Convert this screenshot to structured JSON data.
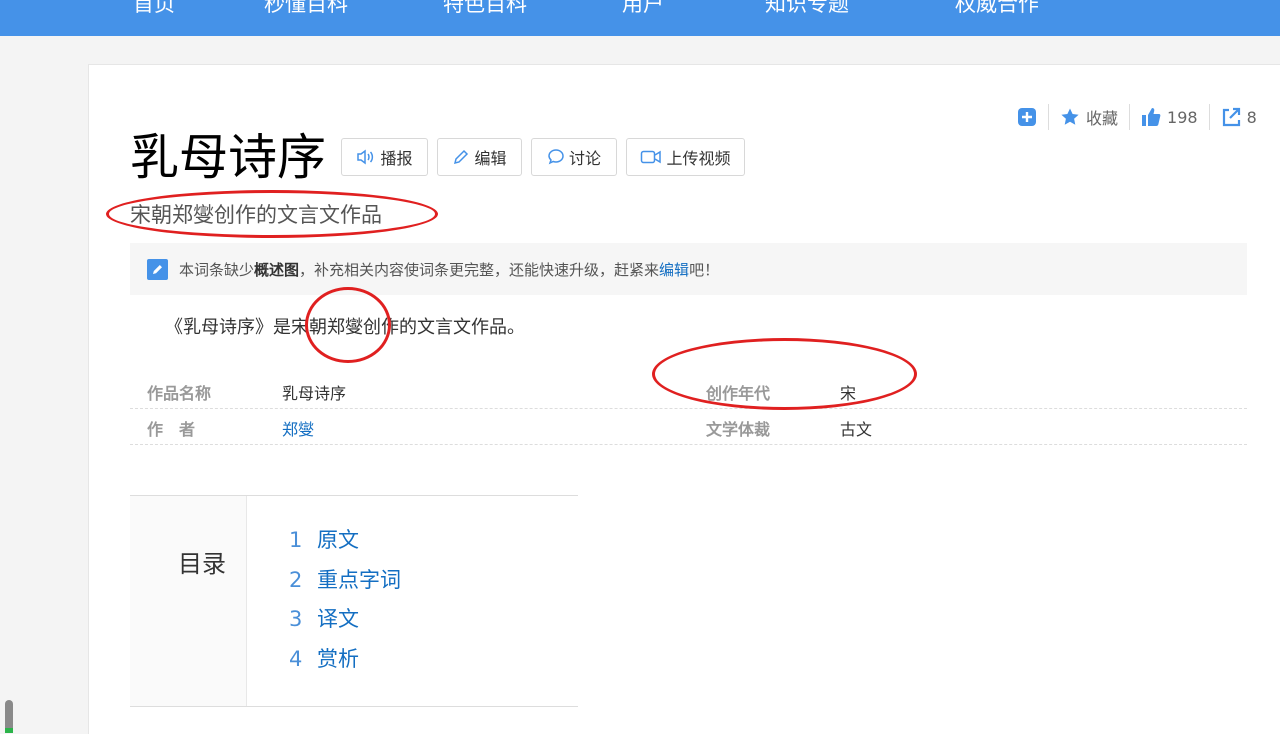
{
  "nav": {
    "items": [
      "首页",
      "秒懂百科",
      "特色百科",
      "用户",
      "知识专题",
      "权威合作"
    ]
  },
  "actions": {
    "collect_label": "收藏",
    "like_count": "198",
    "share_count": "8"
  },
  "entry": {
    "title": "乳母诗序",
    "buttons": {
      "broadcast": "播报",
      "edit": "编辑",
      "discuss": "讨论",
      "upload_video": "上传视频"
    },
    "subtitle": "宋朝郑燮创作的文言文作品",
    "notice": {
      "prefix": "本词条缺少",
      "bold": "概述图",
      "middle": "，补充相关内容使词条更完整，还能快速升级，赶紧来",
      "link": "编辑",
      "suffix": "吧！"
    },
    "summary": "《乳母诗序》是宋朝郑燮创作的文言文作品。"
  },
  "info": {
    "rows": [
      {
        "k1": "作品名称",
        "v1": "乳母诗序",
        "k2": "创作年代",
        "v2": "宋"
      },
      {
        "k1": "作　者",
        "v1": "郑燮",
        "k2": "文学体裁",
        "v2": "古文"
      }
    ]
  },
  "toc": {
    "title": "目录",
    "items": [
      {
        "num": "1",
        "label": "原文"
      },
      {
        "num": "2",
        "label": "重点字词"
      },
      {
        "num": "3",
        "label": "译文"
      },
      {
        "num": "4",
        "label": "赏析"
      }
    ]
  },
  "colors": {
    "nav_bg": "#4592e8",
    "link": "#136ec2",
    "annotation": "#e02020"
  }
}
